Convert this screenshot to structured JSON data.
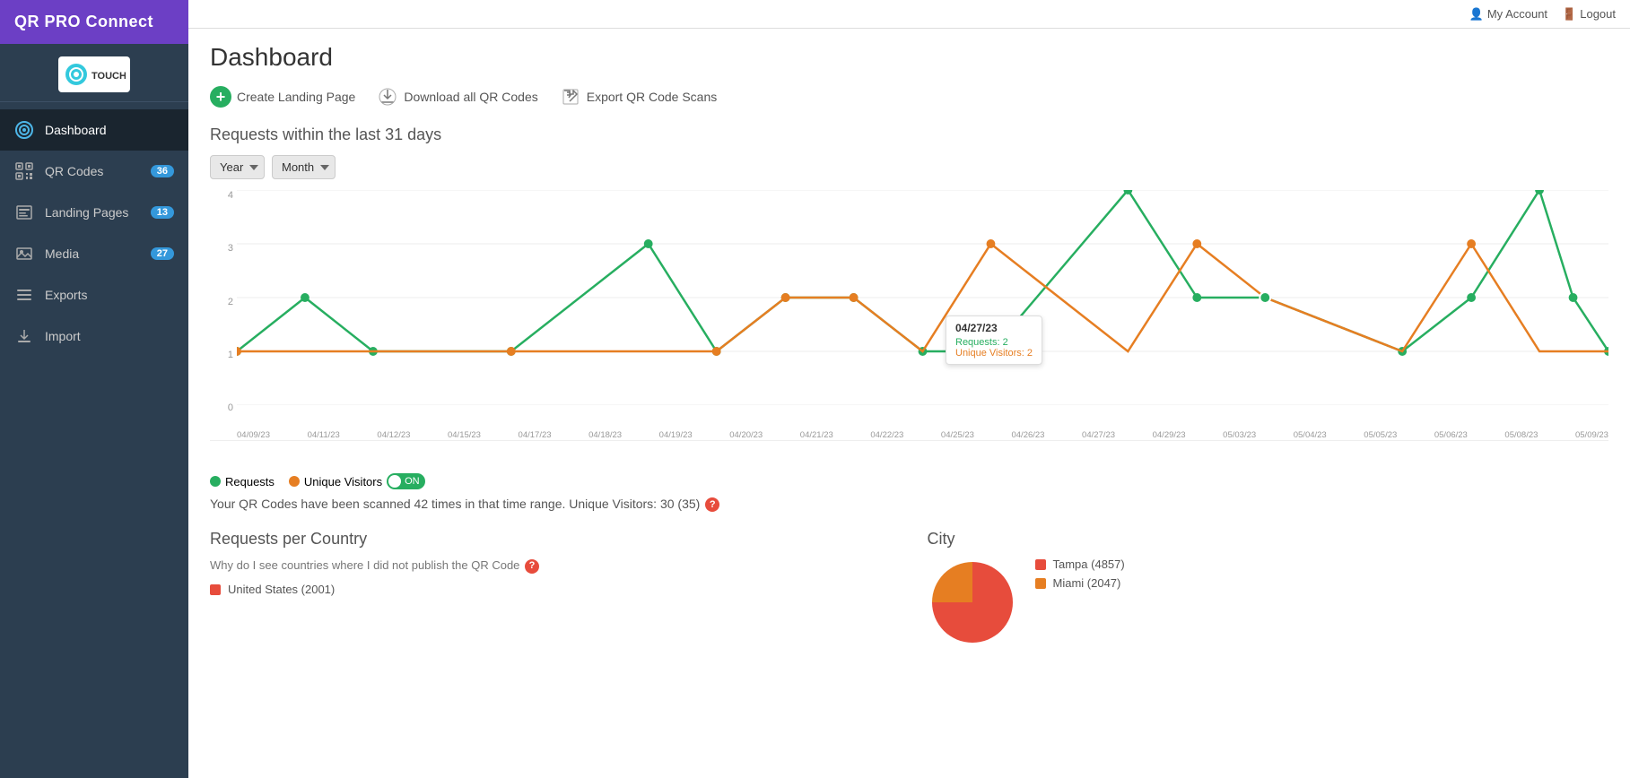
{
  "app": {
    "title": "QR PRO Connect"
  },
  "topbar": {
    "my_account": "My Account",
    "logout": "Logout"
  },
  "sidebar": {
    "logo_text": "TOUCHLESS",
    "items": [
      {
        "id": "dashboard",
        "label": "Dashboard",
        "icon": "dashboard-icon",
        "badge": null,
        "active": true
      },
      {
        "id": "qr-codes",
        "label": "QR Codes",
        "icon": "qr-icon",
        "badge": "36",
        "active": false
      },
      {
        "id": "landing-pages",
        "label": "Landing Pages",
        "icon": "landing-icon",
        "badge": "13",
        "active": false
      },
      {
        "id": "media",
        "label": "Media",
        "icon": "media-icon",
        "badge": "27",
        "active": false
      },
      {
        "id": "exports",
        "label": "Exports",
        "icon": "exports-icon",
        "badge": null,
        "active": false
      },
      {
        "id": "import",
        "label": "Import",
        "icon": "import-icon",
        "badge": null,
        "active": false
      }
    ]
  },
  "main": {
    "page_title": "Dashboard",
    "toolbar": {
      "create_label": "Create Landing Page",
      "download_label": "Download all QR Codes",
      "export_label": "Export QR Code Scans"
    },
    "chart": {
      "section_title": "Requests within the last 31 days",
      "year_filter": "Year",
      "month_filter": "Month",
      "x_labels": [
        "04/09/23",
        "04/11/23",
        "04/12/23",
        "04/15/23",
        "04/17/23",
        "04/18/23",
        "04/19/23",
        "04/20/23",
        "04/21/23",
        "04/22/23",
        "04/25/23",
        "04/26/23",
        "04/27/23",
        "04/29/23",
        "05/03/23",
        "05/04/23",
        "05/05/23",
        "05/06/23",
        "05/08/23",
        "05/09/23"
      ],
      "y_labels": [
        "0",
        "1",
        "2",
        "3",
        "4"
      ],
      "tooltip": {
        "date": "04/27/23",
        "requests_label": "Requests: 2",
        "visitors_label": "Unique Visitors: 2"
      },
      "legend": {
        "requests_label": "Requests",
        "visitors_label": "Unique Visitors",
        "toggle_state": "ON"
      },
      "summary": "Your QR Codes have been scanned 42 times in that time range. Unique Visitors: 30 (35)"
    },
    "country_section": {
      "heading": "Requests per Country",
      "subtext": "Why do I see countries where I did not publish the QR Code",
      "items": [
        {
          "label": "United States (2001)",
          "color": "#e74c3c"
        }
      ]
    },
    "city_section": {
      "heading": "City",
      "items": [
        {
          "label": "Tampa (4857)",
          "color": "#e74c3c"
        },
        {
          "label": "Miami (2047)",
          "color": "#e67e22"
        }
      ]
    }
  }
}
